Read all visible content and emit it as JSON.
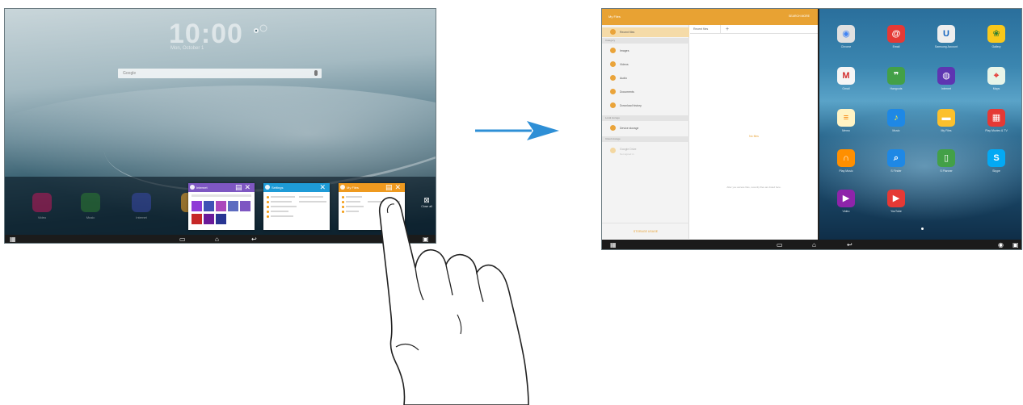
{
  "left_screen": {
    "clock": "10:00",
    "clock_date": "Mon, October 1",
    "search_placeholder": "Google",
    "dim_apps": [
      {
        "label": "Video",
        "color": "#c2185b"
      },
      {
        "label": "Music",
        "color": "#2e7d32"
      },
      {
        "label": "Internet",
        "color": "#3949ab"
      },
      {
        "label": "",
        "color": "#f9a825"
      }
    ],
    "recent_thumbs": [
      {
        "title": "Internet",
        "color": "#7e57c2",
        "kind": "grid"
      },
      {
        "title": "Settings",
        "color": "#1e9bd7",
        "kind": "list"
      },
      {
        "title": "My Files",
        "color": "#ef9a1f",
        "kind": "list"
      }
    ],
    "close_all_label": "Close all",
    "nav": {
      "recent_icon": "▭",
      "home_icon": "⌂",
      "back_icon": "↩",
      "left_icon": "▦",
      "right_icon": "▣"
    }
  },
  "right_screen": {
    "myfiles": {
      "title": "My Files",
      "actions": "SEARCH   MORE",
      "sidebar": {
        "recent": "Recent files",
        "category_header": "Category",
        "categories": [
          "Images",
          "Videos",
          "Audio",
          "Documents",
          "Download history"
        ],
        "local_header": "Local storage",
        "device_storage": "Device storage",
        "cloud_header": "Cloud storage",
        "google_drive": "Google Drive",
        "google_drive_sub": "Not signed in",
        "bottom_action": "STORAGE USAGE"
      },
      "tab_label": "Recent files",
      "tab_plus": "+",
      "no_files": "No files",
      "no_files_hint": "After you access files, recently files are listed here."
    },
    "home_apps": [
      {
        "label": "Chrome",
        "color": "#e0e0e0",
        "glyph": "◉",
        "glyph_color": "#4285f4"
      },
      {
        "label": "Email",
        "color": "#e53935",
        "glyph": "@",
        "glyph_color": "#ffffff"
      },
      {
        "label": "Samsung Account",
        "color": "#eeeeee",
        "glyph": "U",
        "glyph_color": "#1565c0"
      },
      {
        "label": "Gallery",
        "color": "#f9c81b",
        "glyph": "❀",
        "glyph_color": "#2e7d32"
      },
      {
        "label": "Gmail",
        "color": "#f5f5f5",
        "glyph": "M",
        "glyph_color": "#d32f2f"
      },
      {
        "label": "Hangouts",
        "color": "#43a047",
        "glyph": "❞",
        "glyph_color": "#ffffff"
      },
      {
        "label": "Internet",
        "color": "#5e35b1",
        "glyph": "◍",
        "glyph_color": "#ffffff"
      },
      {
        "label": "Maps",
        "color": "#e8f5e9",
        "glyph": "⌖",
        "glyph_color": "#e53935"
      },
      {
        "label": "Memo",
        "color": "#fff3c4",
        "glyph": "≡",
        "glyph_color": "#f57c00"
      },
      {
        "label": "Music",
        "color": "#1e88e5",
        "glyph": "♪",
        "glyph_color": "#ffeb3b"
      },
      {
        "label": "My Files",
        "color": "#fbc02d",
        "glyph": "▬",
        "glyph_color": "#ffffff"
      },
      {
        "label": "Play Movies & TV",
        "color": "#e53935",
        "glyph": "▦",
        "glyph_color": "#ffffff"
      },
      {
        "label": "Play Music",
        "color": "#ff8f00",
        "glyph": "∩",
        "glyph_color": "#ffffff"
      },
      {
        "label": "S Finder",
        "color": "#1e88e5",
        "glyph": "⌕",
        "glyph_color": "#ffffff"
      },
      {
        "label": "S Planner",
        "color": "#43a047",
        "glyph": "▯",
        "glyph_color": "#ffffff"
      },
      {
        "label": "Skype",
        "color": "#03a9f4",
        "glyph": "S",
        "glyph_color": "#ffffff"
      },
      {
        "label": "Video",
        "color": "#8e24aa",
        "glyph": "▶",
        "glyph_color": "#ffffff"
      },
      {
        "label": "YouTube",
        "color": "#e53935",
        "glyph": "▶",
        "glyph_color": "#ffffff"
      }
    ],
    "nav": {
      "recent_icon": "▭",
      "home_icon": "⌂",
      "back_icon": "↩",
      "left_icon": "▦",
      "right_icon": "▣",
      "chrome_icon": "◉"
    }
  },
  "colors": {
    "arrow": "#2e8fd6",
    "myfiles_accent": "#e8a233"
  }
}
